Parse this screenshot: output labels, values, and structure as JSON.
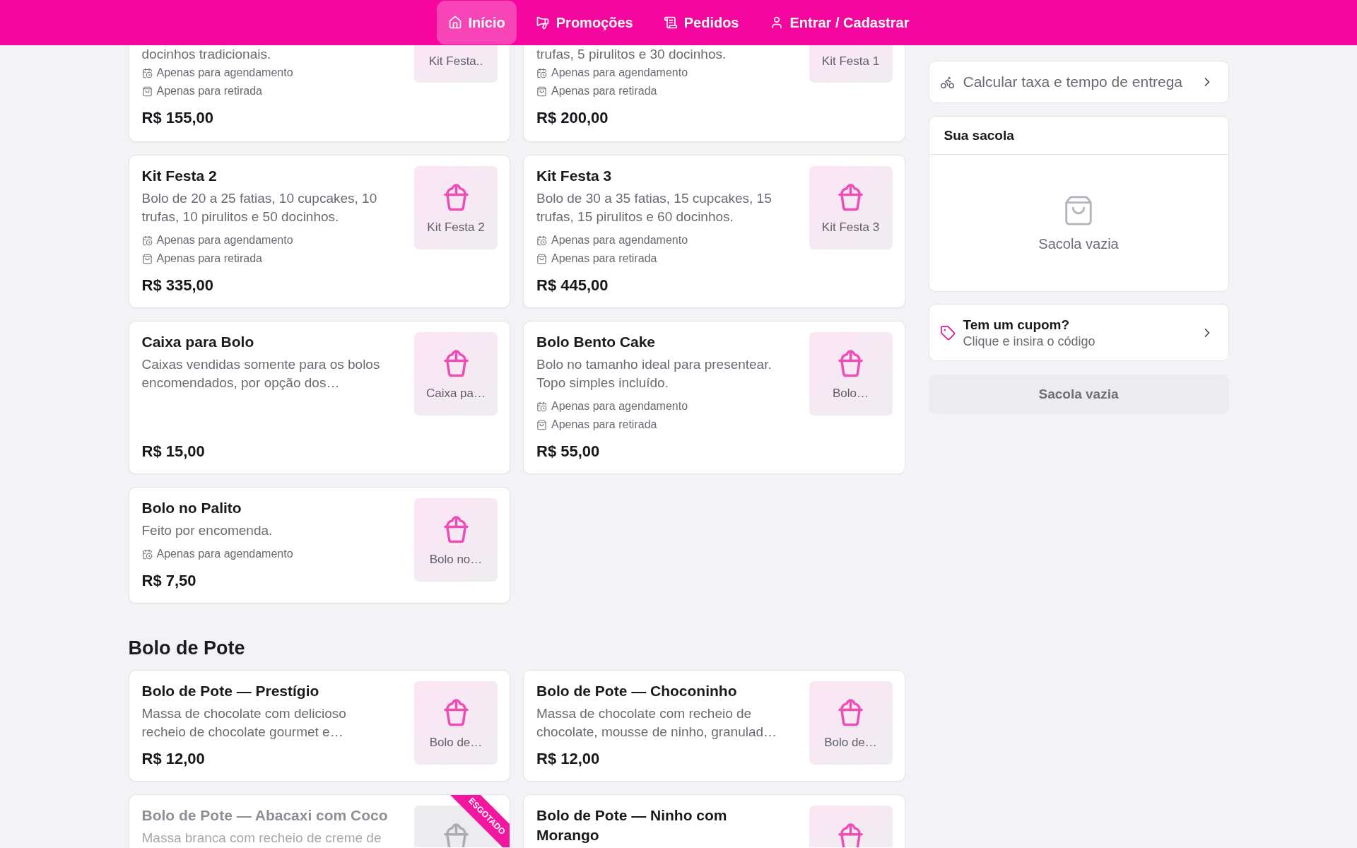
{
  "nav": {
    "items": [
      {
        "label": "Início",
        "selected": true
      },
      {
        "label": "Promoções",
        "selected": false
      },
      {
        "label": "Pedidos",
        "selected": false
      },
      {
        "label": "Entrar / Cadastrar",
        "selected": false
      }
    ]
  },
  "menu": {
    "sections": [
      {
        "products": [
          {
            "kind": "cut_top",
            "description": "docinhos tradicionais.",
            "tags": [
              {
                "kind": "scheduling",
                "label": "Apenas para agendamento"
              },
              {
                "kind": "pickup",
                "label": "Apenas para retirada"
              }
            ],
            "price": "R$ 155,00",
            "image_label": "Kit Festa..",
            "sold_out": false
          },
          {
            "kind": "cut_top",
            "description": "trufas, 5 pirulitos e 30 docinhos.",
            "tags": [
              {
                "kind": "scheduling",
                "label": "Apenas para agendamento"
              },
              {
                "kind": "pickup",
                "label": "Apenas para retirada"
              }
            ],
            "price": "R$ 200,00",
            "image_label": "Kit Festa 1",
            "sold_out": false
          },
          {
            "kind": "full",
            "title": "Kit Festa 2",
            "description": "Bolo de 20 a 25 fatias, 10 cupcakes, 10 trufas, 10 pirulitos e 50 docinhos.",
            "tags": [
              {
                "kind": "scheduling",
                "label": "Apenas para agendamento"
              },
              {
                "kind": "pickup",
                "label": "Apenas para retirada"
              }
            ],
            "price": "R$ 335,00",
            "image_label": "Kit Festa 2",
            "sold_out": false
          },
          {
            "kind": "full",
            "title": "Kit Festa 3",
            "description": "Bolo de 30 a 35 fatias, 15 cupcakes, 15 trufas, 15 pirulitos e 60 docinhos.",
            "tags": [
              {
                "kind": "scheduling",
                "label": "Apenas para agendamento"
              },
              {
                "kind": "pickup",
                "label": "Apenas para retirada"
              }
            ],
            "price": "R$ 445,00",
            "image_label": "Kit Festa 3",
            "sold_out": false
          },
          {
            "kind": "full",
            "title": "Caixa para Bolo",
            "description": "Caixas vendidas somente para os bolos encomendados, por opção dos…",
            "price": "R$ 15,00",
            "image_label": "Caixa pa…",
            "sold_out": false
          },
          {
            "kind": "full",
            "title": "Bolo Bento Cake",
            "description": "Bolo no tamanho ideal para presentear. Topo simples incluído.",
            "tags": [
              {
                "kind": "scheduling",
                "label": "Apenas para agendamento"
              },
              {
                "kind": "pickup",
                "label": "Apenas para retirada"
              }
            ],
            "price": "R$ 55,00",
            "image_label": "Bolo…",
            "sold_out": false
          },
          {
            "kind": "full",
            "title": "Bolo no Palito",
            "description": "Feito por encomenda.",
            "tags": [
              {
                "kind": "scheduling",
                "label": "Apenas para agendamento"
              }
            ],
            "price": "R$ 7,50",
            "image_label": "Bolo no…",
            "sold_out": false
          }
        ]
      },
      {
        "title": "Bolo de Pote",
        "products": [
          {
            "kind": "full",
            "title": "Bolo de Pote — Prestígio",
            "description": "Massa de chocolate com delicioso recheio de chocolate gourmet e…",
            "price": "R$ 12,00",
            "image_label": "Bolo de…",
            "sold_out": false
          },
          {
            "kind": "full",
            "title": "Bolo de Pote — Choconinho",
            "description": "Massa de chocolate com recheio de chocolate, mousse de ninho, granulad…",
            "price": "R$ 12,00",
            "image_label": "Bolo de…",
            "sold_out": false
          },
          {
            "kind": "cut_bottom",
            "title": "Bolo de Pote — Abacaxi com Coco",
            "description": "Massa branca com recheio de creme de",
            "sold_out": true,
            "badge": "ESGOTADO"
          },
          {
            "kind": "cut_bottom",
            "title": "Bolo de Pote — Ninho com Morango",
            "sold_out": false
          }
        ]
      }
    ]
  },
  "sidebar": {
    "delivery_button": {
      "label": "Calcular taxa e tempo de entrega"
    },
    "bag": {
      "title": "Sua sacola",
      "empty_text": "Sacola vazia"
    },
    "coupon": {
      "title": "Tem um cupom?",
      "subtitle": "Clique e insira o código"
    },
    "checkout_button": {
      "label": "Sacola vazia",
      "disabled": true
    }
  }
}
